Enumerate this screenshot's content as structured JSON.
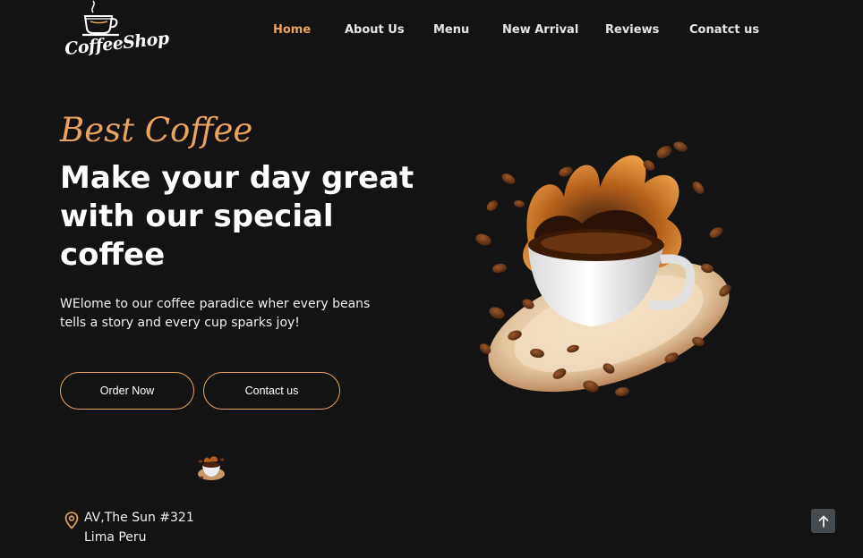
{
  "brand": {
    "logo_text": "CoffeeShop",
    "accent_color": "#e8a35f"
  },
  "nav": {
    "items": [
      {
        "label": "Home",
        "active": true
      },
      {
        "label": "About Us",
        "active": false
      },
      {
        "label": "Menu",
        "active": false
      },
      {
        "label": "New Arrival",
        "active": false
      },
      {
        "label": "Reviews",
        "active": false
      },
      {
        "label": "Conatct us",
        "active": false
      }
    ]
  },
  "hero": {
    "tagline": "Best Coffee",
    "headline": "Make your day great with our special coffee",
    "intro": "WElome to our coffee paradice wher every beans tells a story and every cup sparks joy!",
    "order_button": "Order Now",
    "contact_button": "Contact us",
    "image_icon": "coffee-splash-cup-icon"
  },
  "address": {
    "icon": "location-pin-icon",
    "line1": "AV,The Sun #321",
    "line2": "Lima Peru"
  },
  "back_to_top": {
    "icon": "arrow-up-icon"
  }
}
